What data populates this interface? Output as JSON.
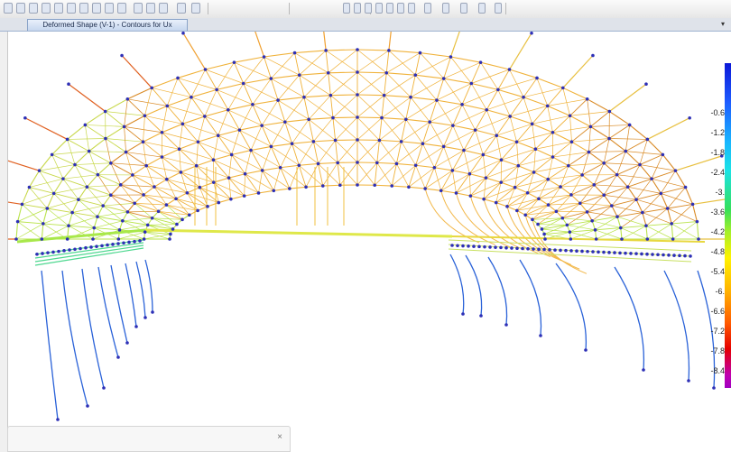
{
  "window": {
    "tab_title": "Deformed Shape (V-1) - Contours for Ux",
    "tab_menu_glyph": "▾"
  },
  "toolbar": {
    "icons": [
      "zoom-in-icon",
      "zoom-out-icon",
      "zoom-window-icon",
      "zoom-previous-icon",
      "pan-icon",
      "rotate-icon",
      "view-3d-icon",
      "view-xy-icon",
      "view-xz-icon",
      "view-yz-icon",
      "refresh-icon",
      "undo-icon",
      "select-icon",
      "grid-icon",
      "run-icon"
    ]
  },
  "legend": {
    "labels": [
      "-0.6",
      "-1.2",
      "-1.8",
      "-2.4",
      "-3.",
      "-3.6",
      "-4.2",
      "-4.8",
      "-5.4",
      "-6.",
      "-6.6",
      "-7.2",
      "-7.8",
      "-8.4"
    ],
    "colors": [
      "#0b18d8",
      "#1d5bff",
      "#18b4ff",
      "#1ae3e6",
      "#34e05a",
      "#a5f028",
      "#fff200",
      "#ffb300",
      "#ff5a00",
      "#e60000",
      "#c000b0"
    ]
  },
  "status_panel": {
    "close_glyph": "×"
  },
  "colors": {
    "arch": "#f0b23a",
    "arch_dark": "#d98a25",
    "node": "#2d2fb6",
    "deck": "#dfe84a",
    "cable_top": "#e06020",
    "column": "#2a62d8"
  }
}
